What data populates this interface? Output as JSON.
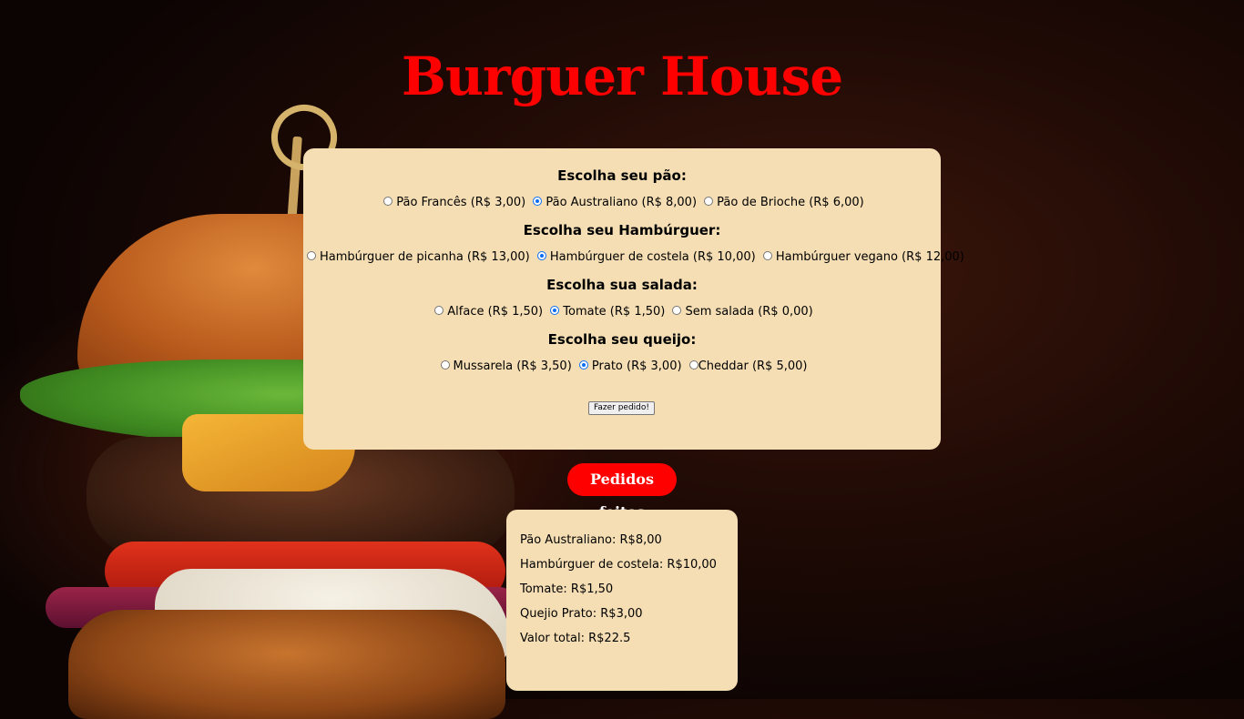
{
  "page": {
    "title": "Burguer House"
  },
  "form": {
    "groups": [
      {
        "title": "Escolha seu pão:",
        "options": [
          {
            "label": "Pão Francês (R$ 3,00)",
            "checked": false
          },
          {
            "label": "Pão Australiano (R$ 8,00)",
            "checked": true
          },
          {
            "label": "Pão de Brioche (R$ 6,00)",
            "checked": false
          }
        ]
      },
      {
        "title": "Escolha seu Hambúrguer:",
        "options": [
          {
            "label": "Hambúrguer de picanha (R$ 13,00)",
            "checked": false
          },
          {
            "label": "Hambúrguer de costela (R$ 10,00)",
            "checked": true
          },
          {
            "label": "Hambúrguer vegano (R$ 12,00)",
            "checked": false
          }
        ]
      },
      {
        "title": "Escolha sua salada:",
        "options": [
          {
            "label": "Alface (R$ 1,50)",
            "checked": false
          },
          {
            "label": "Tomate (R$ 1,50)",
            "checked": true
          },
          {
            "label": "Sem salada (R$ 0,00)",
            "checked": false
          }
        ]
      },
      {
        "title": "Escolha seu queijo:",
        "options": [
          {
            "label": "Mussarela (R$ 3,50)",
            "checked": false
          },
          {
            "label": "Prato (R$ 3,00)",
            "checked": true
          },
          {
            "label": "Cheddar (R$ 5,00)",
            "checked": false
          }
        ]
      }
    ],
    "submit_label": "Fazer pedido!"
  },
  "orders": {
    "badge_label": "Pedidos feitos",
    "lines": [
      "Pão Australiano: R$8,00",
      "Hambúrguer de costela: R$10,00",
      "Tomate: R$1,50",
      "Quejio Prato: R$3,00",
      "Valor total: R$22.5"
    ]
  },
  "colors": {
    "title": "#ff0000",
    "panel": "#f5deb3",
    "radio_checked": "#0b6ef5",
    "badge": "#ff0000"
  }
}
